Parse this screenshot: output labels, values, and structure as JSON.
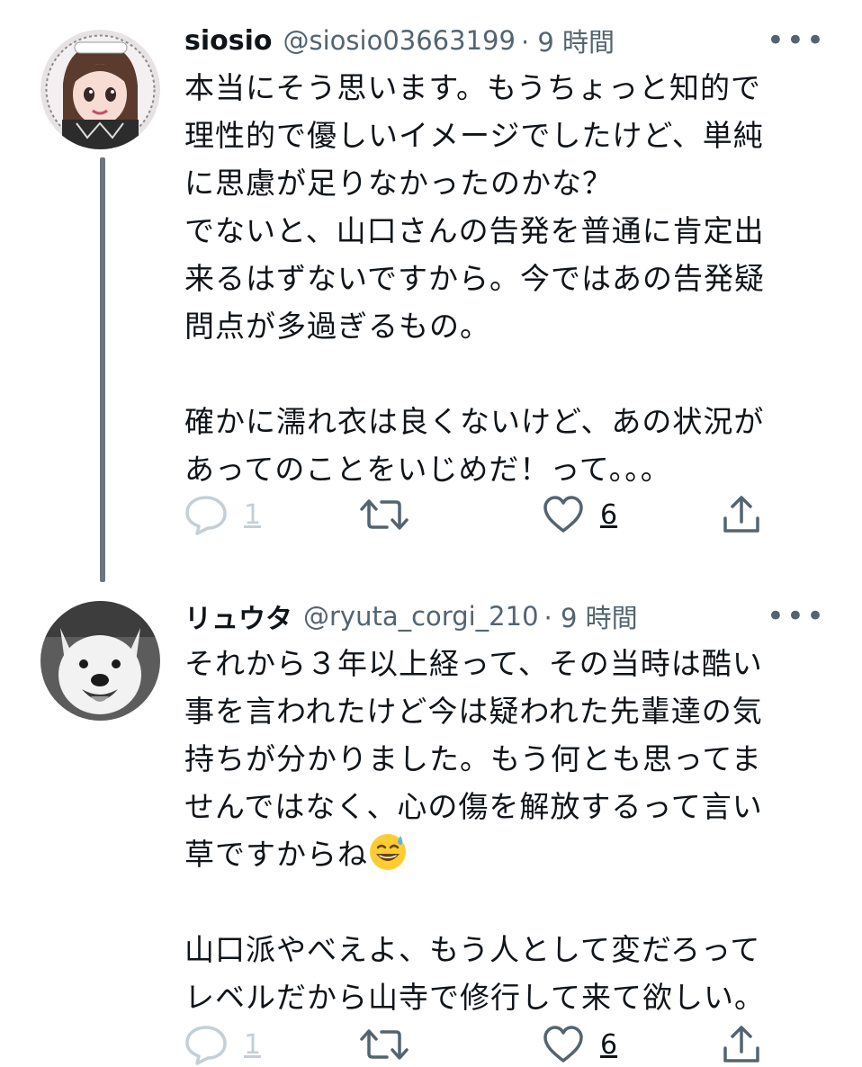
{
  "tweets": [
    {
      "name": "siosio",
      "handle": "@siosio03663199",
      "time": "· 9 時間",
      "more": "•••",
      "lines": [
        "本当にそう思います。もうちょっと知的で",
        "理性的で優しいイメージでしたけど、単純",
        "に思慮が足りなかったのかな？",
        "でないと、山口さんの告発を普通に肯定出",
        "来るはずないですから。今ではあの告発疑",
        "問点が多過ぎるもの。",
        "",
        "確かに濡れ衣は良くないけど、あの状況が",
        "あってのことをいじめだ！って。。。"
      ],
      "reply_count": "1",
      "like_count": "6"
    },
    {
      "name": "リュウタ",
      "handle": "@ryuta_corgi_210",
      "time": "· 9 時間",
      "more": "•••",
      "lines": [
        "それから３年以上経って、その当時は酷い",
        "事を言われたけど今は疑われた先輩達の気",
        "持ちが分かりました。もう何とも思ってま",
        "せんではなく、心の傷を解放するって言い",
        "草ですからね",
        "",
        "山口派やべえよ、もう人として変だろって",
        "レベルだから山寺で修行して来て欲しい。"
      ],
      "emoji": "sweat-smile-emoji",
      "reply_count": "1",
      "like_count": "6"
    }
  ],
  "icons": [
    "reply-icon",
    "retweet-icon",
    "like-icon",
    "share-icon",
    "more-icon"
  ],
  "colors": {
    "text": "#0f1419",
    "secondary": "#536471",
    "muted": "#c4cfd6",
    "thread": "#6e767d"
  }
}
